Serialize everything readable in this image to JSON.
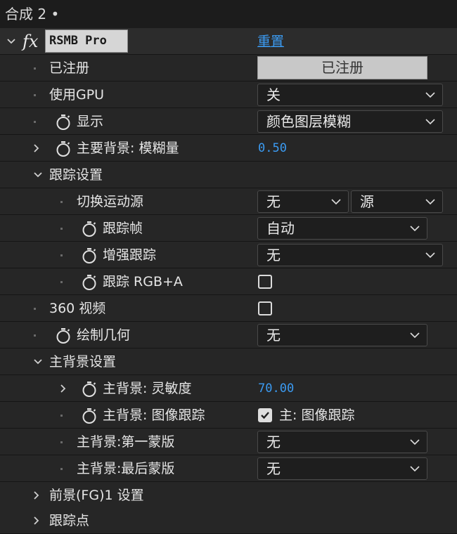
{
  "comp": {
    "title": "合成 2 •"
  },
  "effect": {
    "name": "RSMB Pro",
    "reset": "重置"
  },
  "rows": {
    "registered": {
      "label": "已注册",
      "button": "已注册"
    },
    "use_gpu": {
      "label": "使用GPU",
      "value": "关"
    },
    "display": {
      "label": "显示",
      "value": "颜色图层模糊"
    },
    "bg_blur": {
      "label": "主要背景: 模糊量",
      "value": "0.50"
    },
    "tracking_settings": {
      "label": "跟踪设置"
    },
    "switch_source": {
      "label": "切换运动源",
      "value1": "无",
      "value2": "源"
    },
    "track_frames": {
      "label": "跟踪帧",
      "value": "自动"
    },
    "enhance_tracking": {
      "label": "增强跟踪",
      "value": "无"
    },
    "track_rgba": {
      "label": "跟踪 RGB+A",
      "checked": false
    },
    "video_360": {
      "label": "360 视频",
      "checked": false
    },
    "draw_geometry": {
      "label": "绘制几何",
      "value": "无"
    },
    "main_bg_settings": {
      "label": "主背景设置"
    },
    "bg_sensitivity": {
      "label": "主背景: 灵敏度",
      "value": "70.00"
    },
    "bg_image_tracking": {
      "label": "主背景: 图像跟踪",
      "checked": true,
      "check_label": "主: 图像跟踪"
    },
    "bg_first_mask": {
      "label": "主背景:第一蒙版",
      "value": "无"
    },
    "bg_last_mask": {
      "label": "主背景:最后蒙版",
      "value": "无"
    },
    "fg1_settings": {
      "label": "前景(FG)1 设置"
    },
    "track_points": {
      "label": "跟踪点"
    }
  },
  "colors": {
    "accent": "#3b9bf2",
    "background": "#232323"
  }
}
